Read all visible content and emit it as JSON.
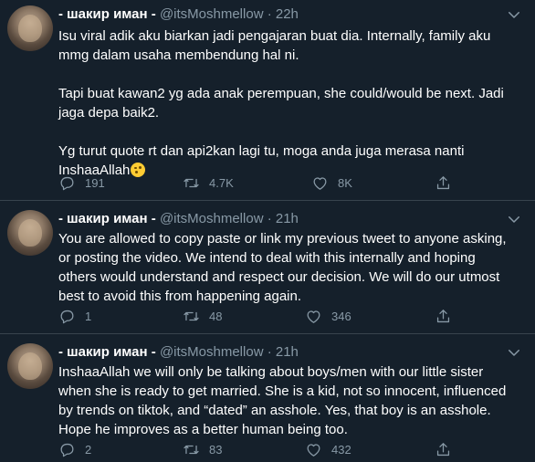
{
  "tweets": [
    {
      "name": "- шакир иман -",
      "handle": "@itsMoshmellow",
      "separator": "·",
      "time": "22h",
      "text": "Isu viral adik aku biarkan jadi pengajaran buat dia. Internally, family aku\nmmg dalam usaha membendung hal ni.\n\nTapi buat kawan2 yg ada anak perempuan, she could/would be next. Jadi\njaga depa baik2.\n\nYg turut quote rt dan api2kan lagi tu, moga anda juga merasa nanti\nInshaaAllah",
      "emoji": "winking-face",
      "replies": "191",
      "retweets": "4.7K",
      "likes": "8K"
    },
    {
      "name": "- шакир иман -",
      "handle": "@itsMoshmellow",
      "separator": "·",
      "time": "21h",
      "text": "You are allowed to copy paste or link my previous tweet to anyone asking,\nor posting the video. We intend to deal with this internally and hoping\nothers would understand and respect our decision. We will do our utmost\nbest to avoid this from happening again.",
      "replies": "1",
      "retweets": "48",
      "likes": "346"
    },
    {
      "name": "- шакир иман -",
      "handle": "@itsMoshmellow",
      "separator": "·",
      "time": "21h",
      "text": "InshaaAllah we will only be talking about boys/men with our little sister\nwhen she is ready to get married. She is a kid, not so innocent, influenced\nby trends on tiktok, and “dated” an asshole. Yes, that boy is an asshole.\nHope he improves as a better human being too.",
      "replies": "2",
      "retweets": "83",
      "likes": "432"
    }
  ],
  "icons": {
    "reply": "reply-icon",
    "retweet": "retweet-icon",
    "like": "heart-icon",
    "share": "share-icon",
    "more": "chevron-down-icon"
  },
  "colors": {
    "background": "#15202b",
    "secondary_text": "#8899a6",
    "divider": "#38444d"
  }
}
